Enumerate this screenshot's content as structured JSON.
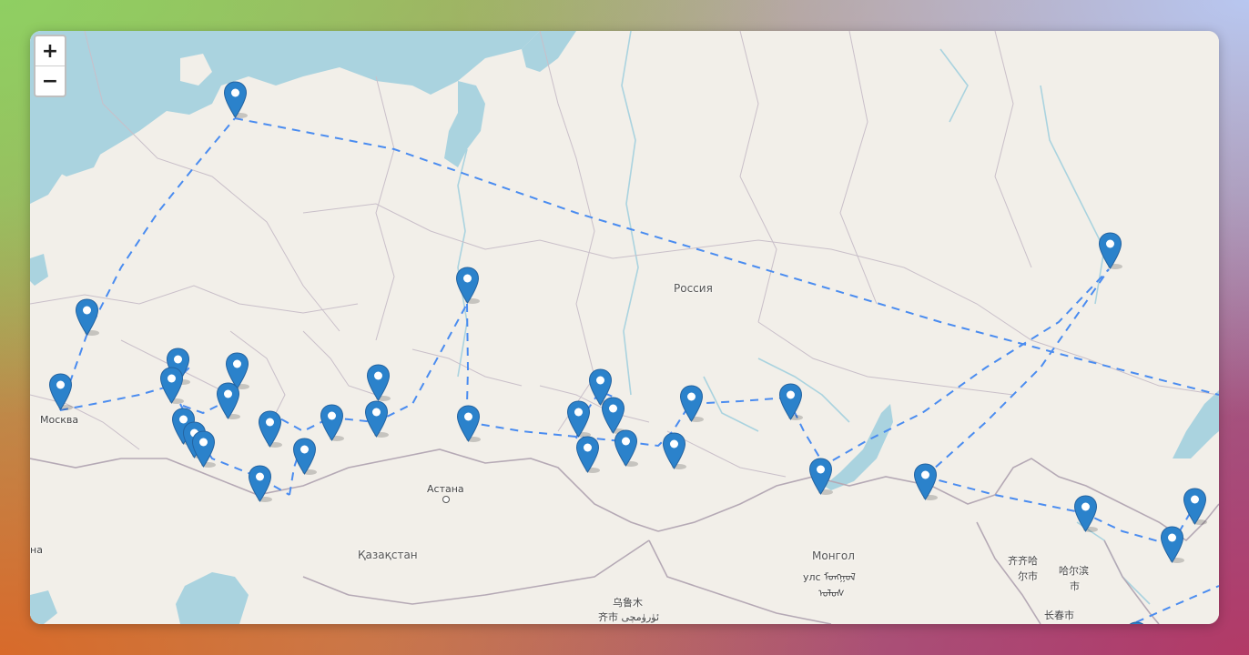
{
  "map": {
    "zoom_in_label": "+",
    "zoom_out_label": "−",
    "colors": {
      "land": "#f2efe9",
      "water": "#aad3df",
      "border": "#b5a9b5",
      "route": "#4a8cf0",
      "marker": "#2b82cb"
    },
    "labels": {
      "russia": "Россия",
      "moscow": "Москва",
      "astana": "Астана",
      "kazakhstan": "Қазақстан",
      "mongolia_1": "Монгол",
      "mongolia_2": "улс ᠮᠣᠩᠭᠣᠯ",
      "mongolia_3": "ᠤᠯᠤᠰ",
      "qiqihar_1": "齐齐哈",
      "qiqihar_2": "尔市",
      "harbin_1": "哈尔滨",
      "harbin_2": "市",
      "urumqi_1": "乌鲁木",
      "urumqi_2": "齐市 ئۈرۈمچى",
      "changchun": "长春市",
      "edge_left": "на"
    },
    "marker_icon": "map-pin-icon",
    "marker_count": 33
  }
}
